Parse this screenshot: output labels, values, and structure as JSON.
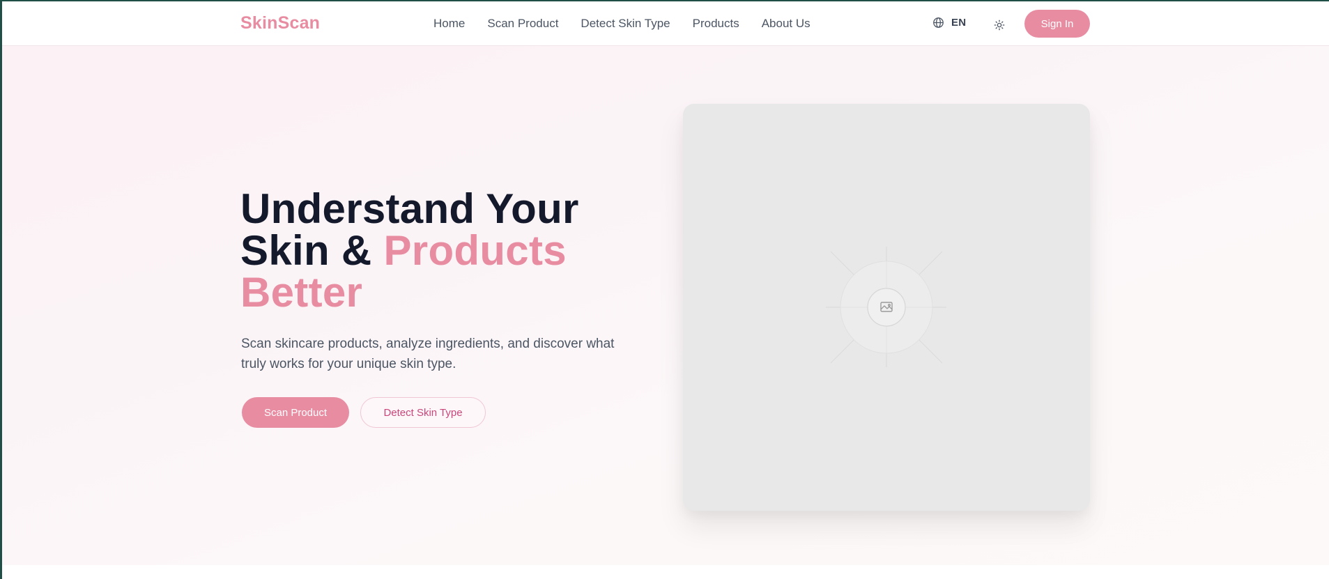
{
  "brand": {
    "name": "SkinScan",
    "accent_color": "#e88ca2"
  },
  "nav": {
    "items": [
      {
        "label": "Home"
      },
      {
        "label": "Scan Product"
      },
      {
        "label": "Detect Skin Type"
      },
      {
        "label": "Products"
      },
      {
        "label": "About Us"
      }
    ]
  },
  "header": {
    "language": {
      "icon": "globe-icon",
      "label": "EN"
    },
    "theme_toggle": {
      "icon": "sun-icon"
    },
    "signin_label": "Sign In"
  },
  "hero": {
    "headline": {
      "line1": "Understand Your",
      "line2_plain": "Skin & ",
      "line2_accent": "Products",
      "line3_accent": "Better"
    },
    "subtext": "Scan skincare products, analyze ingredients, and discover what truly works for your unique skin type.",
    "primary_button": "Scan Product",
    "secondary_button": "Detect Skin Type",
    "image_placeholder_icon": "image-icon"
  }
}
